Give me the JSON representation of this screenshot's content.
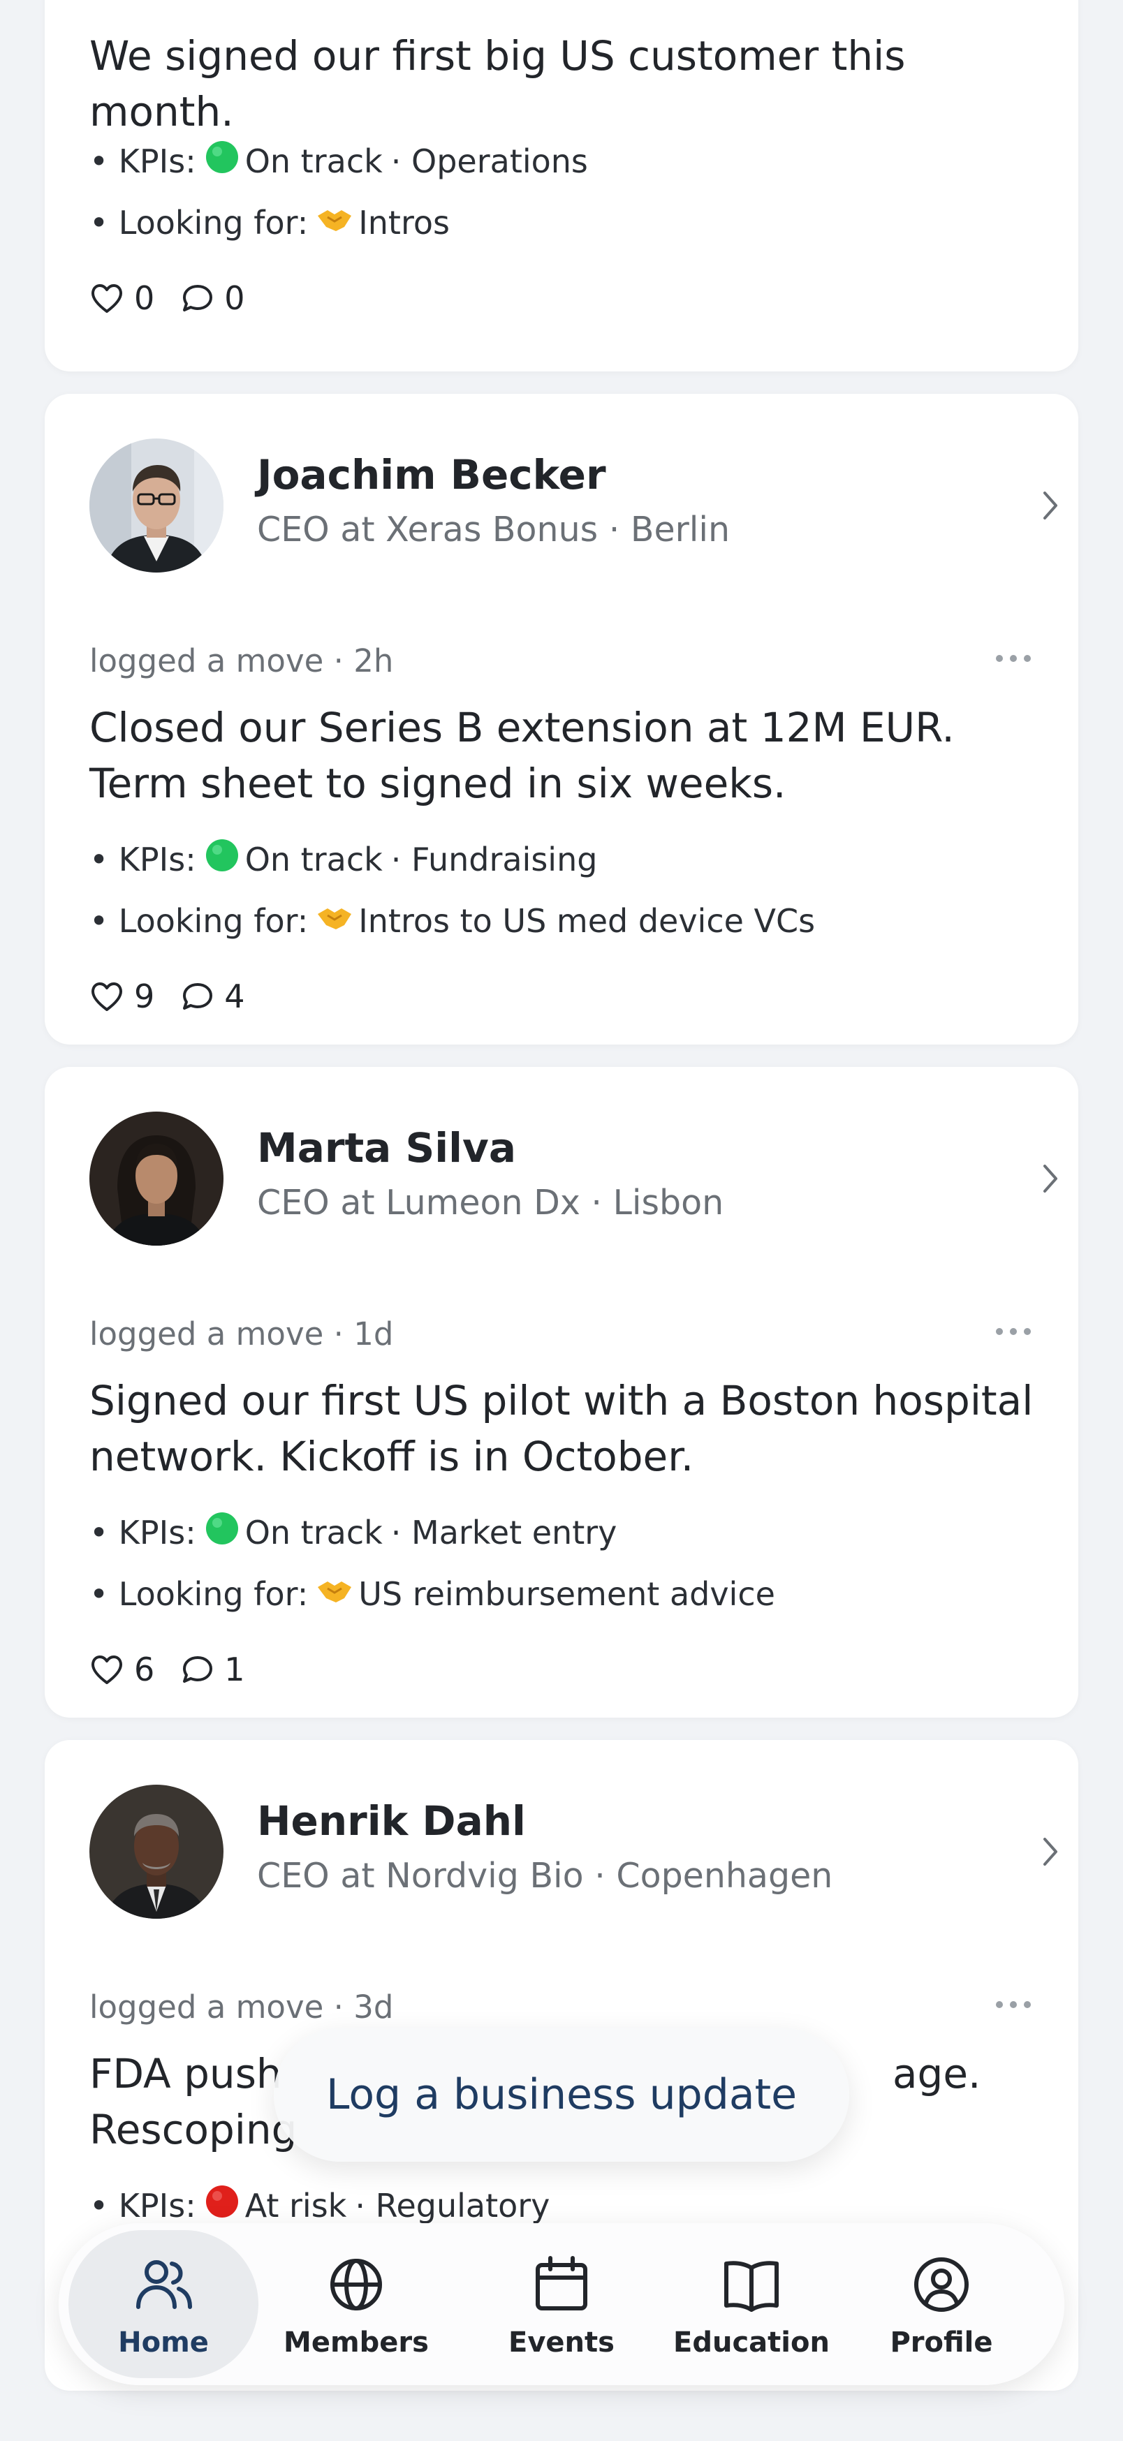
{
  "posts": [
    {
      "text": "We signed our first big US customer this month.",
      "kpi_label": "• KPIs:",
      "kpi_status": "On track",
      "kpi_area": "· Operations",
      "looking_label": "• Looking for:",
      "looking_value": "Intros",
      "likes": "0",
      "comments": "0"
    },
    {
      "name": "Joachim Becker",
      "role": "CEO at Xeras Bonus · Berlin",
      "meta": "logged a move · 2h",
      "text": "Closed our Series B extension at 12M EUR. Term sheet to signed in six weeks.",
      "kpi_label": "• KPIs:",
      "kpi_status": "On track",
      "kpi_area": "· Fundraising",
      "looking_label": "• Looking for:",
      "looking_value": "Intros to US med device VCs",
      "likes": "9",
      "comments": "4"
    },
    {
      "name": "Marta Silva",
      "role": "CEO at Lumeon Dx · Lisbon",
      "meta": "logged a move · 1d",
      "text": "Signed our first US pilot with a Boston hospital network. Kickoff is in October.",
      "kpi_label": "• KPIs:",
      "kpi_status": "On track",
      "kpi_area": "· Market entry",
      "looking_label": "• Looking for:",
      "looking_value": "US reimbursement advice",
      "likes": "6",
      "comments": "1"
    },
    {
      "name": "Henrik Dahl",
      "role": "CEO at Nordvig Bio · Copenhagen",
      "meta": "logged a move · 3d",
      "text_visible_start": "FDA push",
      "text_visible_end": "age.",
      "text_line2_start": "Rescoping",
      "kpi_label": "• KPIs:",
      "kpi_status": "At risk",
      "kpi_area": "· Regulatory"
    }
  ],
  "fab": {
    "label": "Log a business update"
  },
  "nav": [
    {
      "label": "Home",
      "icon": "users-icon",
      "active": true
    },
    {
      "label": "Members",
      "icon": "globe-icon",
      "active": false
    },
    {
      "label": "Events",
      "icon": "calendar-icon",
      "active": false
    },
    {
      "label": "Education",
      "icon": "book-icon",
      "active": false
    },
    {
      "label": "Profile",
      "icon": "user-circle-icon",
      "active": false
    }
  ],
  "colors": {
    "on_track": "#22c55e",
    "at_risk": "#e0201b",
    "accent": "#1f3c62"
  }
}
